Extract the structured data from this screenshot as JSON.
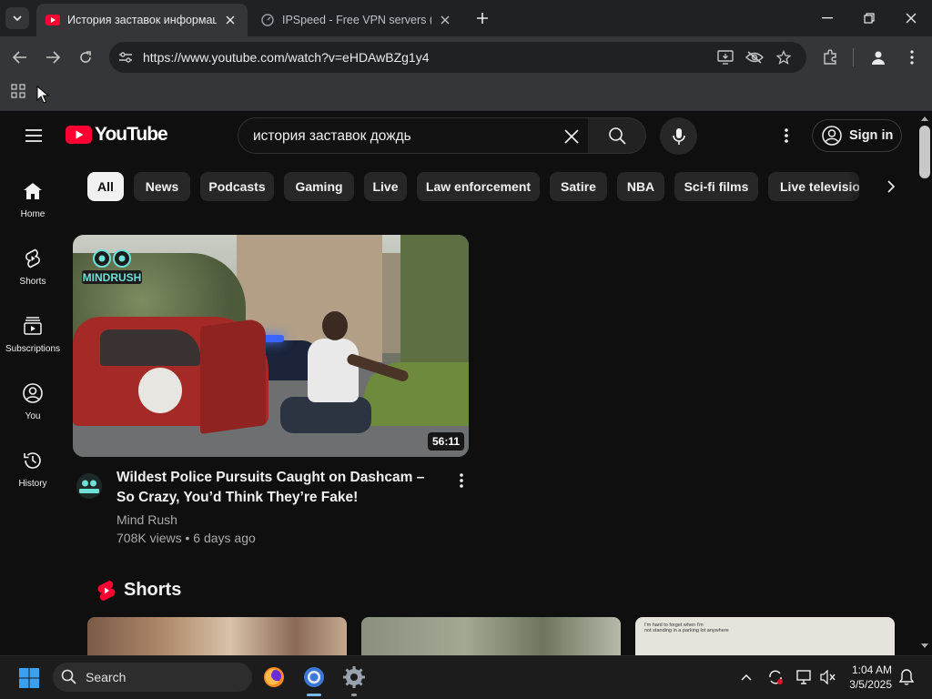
{
  "browser": {
    "tabs": [
      {
        "title": "История заставок информаци",
        "active": true,
        "favicon": "youtube-favicon"
      },
      {
        "title": "IPSpeed - Free VPN servers (SSI",
        "active": false,
        "favicon": "ipspeed-favicon"
      }
    ],
    "url": "https://www.youtube.com/watch?v=eHDAwBZg1y4",
    "icons": [
      "tab-search-icon",
      "new-tab-icon",
      "minimize-icon",
      "restore-icon",
      "close-window-icon",
      "back-icon",
      "forward-icon",
      "reload-icon",
      "site-info-icon",
      "install-app-icon",
      "tracking-protection-icon",
      "bookmark-star-icon",
      "extensions-icon",
      "profile-icon",
      "browser-menu-icon",
      "apps-grid-icon"
    ]
  },
  "youtube": {
    "logo_text": "YouTube",
    "search": {
      "query": "история заставок дождь"
    },
    "signin_label": "Sign in",
    "sidebar": [
      {
        "label": "Home",
        "icon": "home-icon"
      },
      {
        "label": "Shorts",
        "icon": "shorts-icon"
      },
      {
        "label": "Subscriptions",
        "icon": "subscriptions-icon"
      },
      {
        "label": "You",
        "icon": "you-icon"
      },
      {
        "label": "History",
        "icon": "history-icon"
      }
    ],
    "chips": [
      "All",
      "News",
      "Podcasts",
      "Gaming",
      "Live",
      "Law enforcement",
      "Satire",
      "NBA",
      "Sci-fi films",
      "Live televisio"
    ],
    "active_chip": "All",
    "video": {
      "duration": "56:11",
      "title": "Wildest Police Pursuits Caught on Dashcam – So Crazy, You’d Think They’re Fake!",
      "channel": "Mind Rush",
      "meta": "708K views • 6 days ago",
      "thumbnail_logo": "MINDRUSH"
    },
    "shorts_heading": "Shorts",
    "short_card_caption": "I'm hard to forget when I'm\nnot standing in a parking lot anywhere"
  },
  "taskbar": {
    "search_label": "Search",
    "apps": [
      "firefox-icon",
      "chrome-icon",
      "settings-icon"
    ],
    "time": "1:04 AM",
    "date": "3/5/2025"
  },
  "colors": {
    "youtube_red": "#ff0033",
    "background": "#0f0f0f",
    "chip_bg": "#272727",
    "secondary_text": "#aaaaaa"
  }
}
